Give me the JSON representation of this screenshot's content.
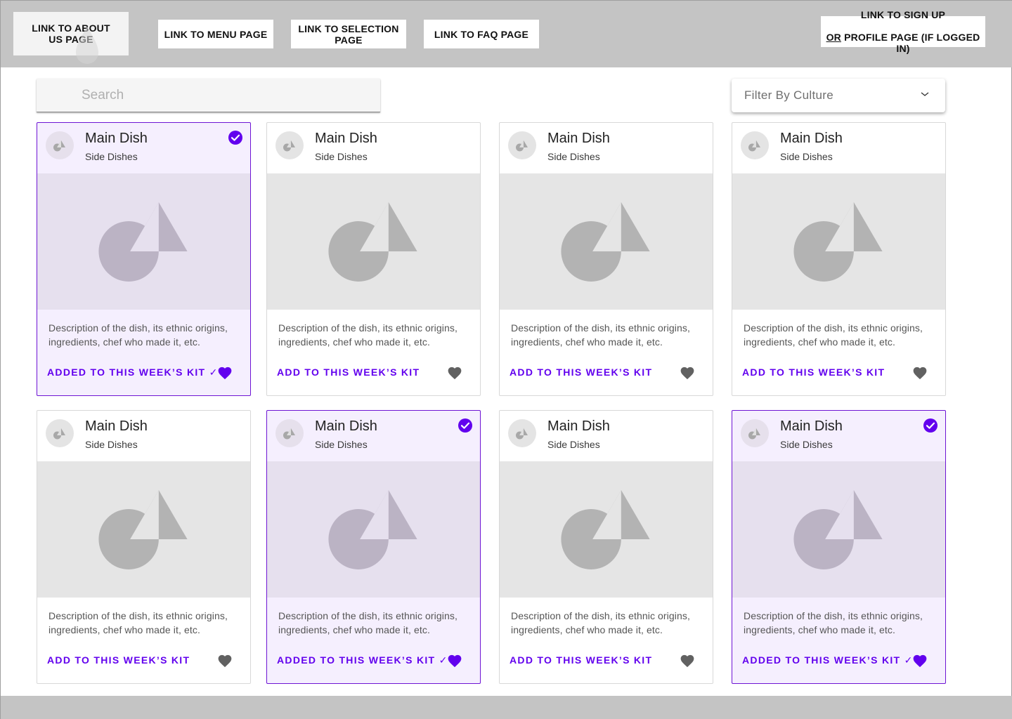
{
  "nav": {
    "about": "LINK TO ABOUT\nUS PAGE",
    "menu": "LINK TO MENU PAGE",
    "selection": "LINK TO SELECTION\nPAGE",
    "faq": "LINK TO FAQ PAGE",
    "signup_line1": "LINK TO SIGN UP",
    "signup_or": "OR",
    "signup_line2": " PROFILE PAGE (IF LOGGED IN)"
  },
  "search": {
    "placeholder": "Search"
  },
  "filter": {
    "label": "Filter By Culture",
    "icon": "chevron-down-icon"
  },
  "colors": {
    "accent": "#6200ee",
    "selected_border": "#6e14d4",
    "selected_bg": "#f5effe",
    "heart_active": "#6200ee",
    "heart_inactive": "#616161",
    "nav_bg": "#c4c4c4"
  },
  "cards": [
    {
      "title": "Main Dish",
      "subtitle": "Side Dishes",
      "description": "Description of the dish, its ethnic origins, ingredients,  chef who made it, etc.",
      "action": "ADDED TO THIS WEEK’S KIT ✓",
      "selected": true,
      "favorited": true
    },
    {
      "title": "Main Dish",
      "subtitle": "Side Dishes",
      "description": "Description of the dish, its ethnic origins, ingredients,  chef who made it, etc.",
      "action": "ADD TO THIS WEEK’S KIT",
      "selected": false,
      "favorited": false
    },
    {
      "title": "Main Dish",
      "subtitle": "Side Dishes",
      "description": "Description of the dish, its ethnic origins, ingredients,  chef who made it, etc.",
      "action": "ADD TO THIS WEEK’S KIT",
      "selected": false,
      "favorited": false
    },
    {
      "title": "Main Dish",
      "subtitle": "Side Dishes",
      "description": "Description of the dish, its ethnic origins, ingredients,  chef who made it, etc.",
      "action": "ADD TO THIS WEEK’S KIT",
      "selected": false,
      "favorited": false
    },
    {
      "title": "Main Dish",
      "subtitle": "Side Dishes",
      "description": "Description of the dish, its ethnic origins, ingredients,  chef who made it, etc.",
      "action": "ADD TO THIS WEEK’S KIT",
      "selected": false,
      "favorited": false
    },
    {
      "title": "Main Dish",
      "subtitle": "Side Dishes",
      "description": "Description of the dish, its ethnic origins, ingredients,  chef who made it, etc.",
      "action": "ADDED TO THIS WEEK’S KIT ✓",
      "selected": true,
      "favorited": true
    },
    {
      "title": "Main Dish",
      "subtitle": "Side Dishes",
      "description": "Description of the dish, its ethnic origins, ingredients,  chef who made it, etc.",
      "action": "ADD TO THIS WEEK’S KIT",
      "selected": false,
      "favorited": false
    },
    {
      "title": "Main Dish",
      "subtitle": "Side Dishes",
      "description": "Description of the dish, its ethnic origins, ingredients,  chef who made it, etc.",
      "action": "ADDED TO THIS WEEK’S KIT ✓",
      "selected": true,
      "favorited": true
    }
  ]
}
